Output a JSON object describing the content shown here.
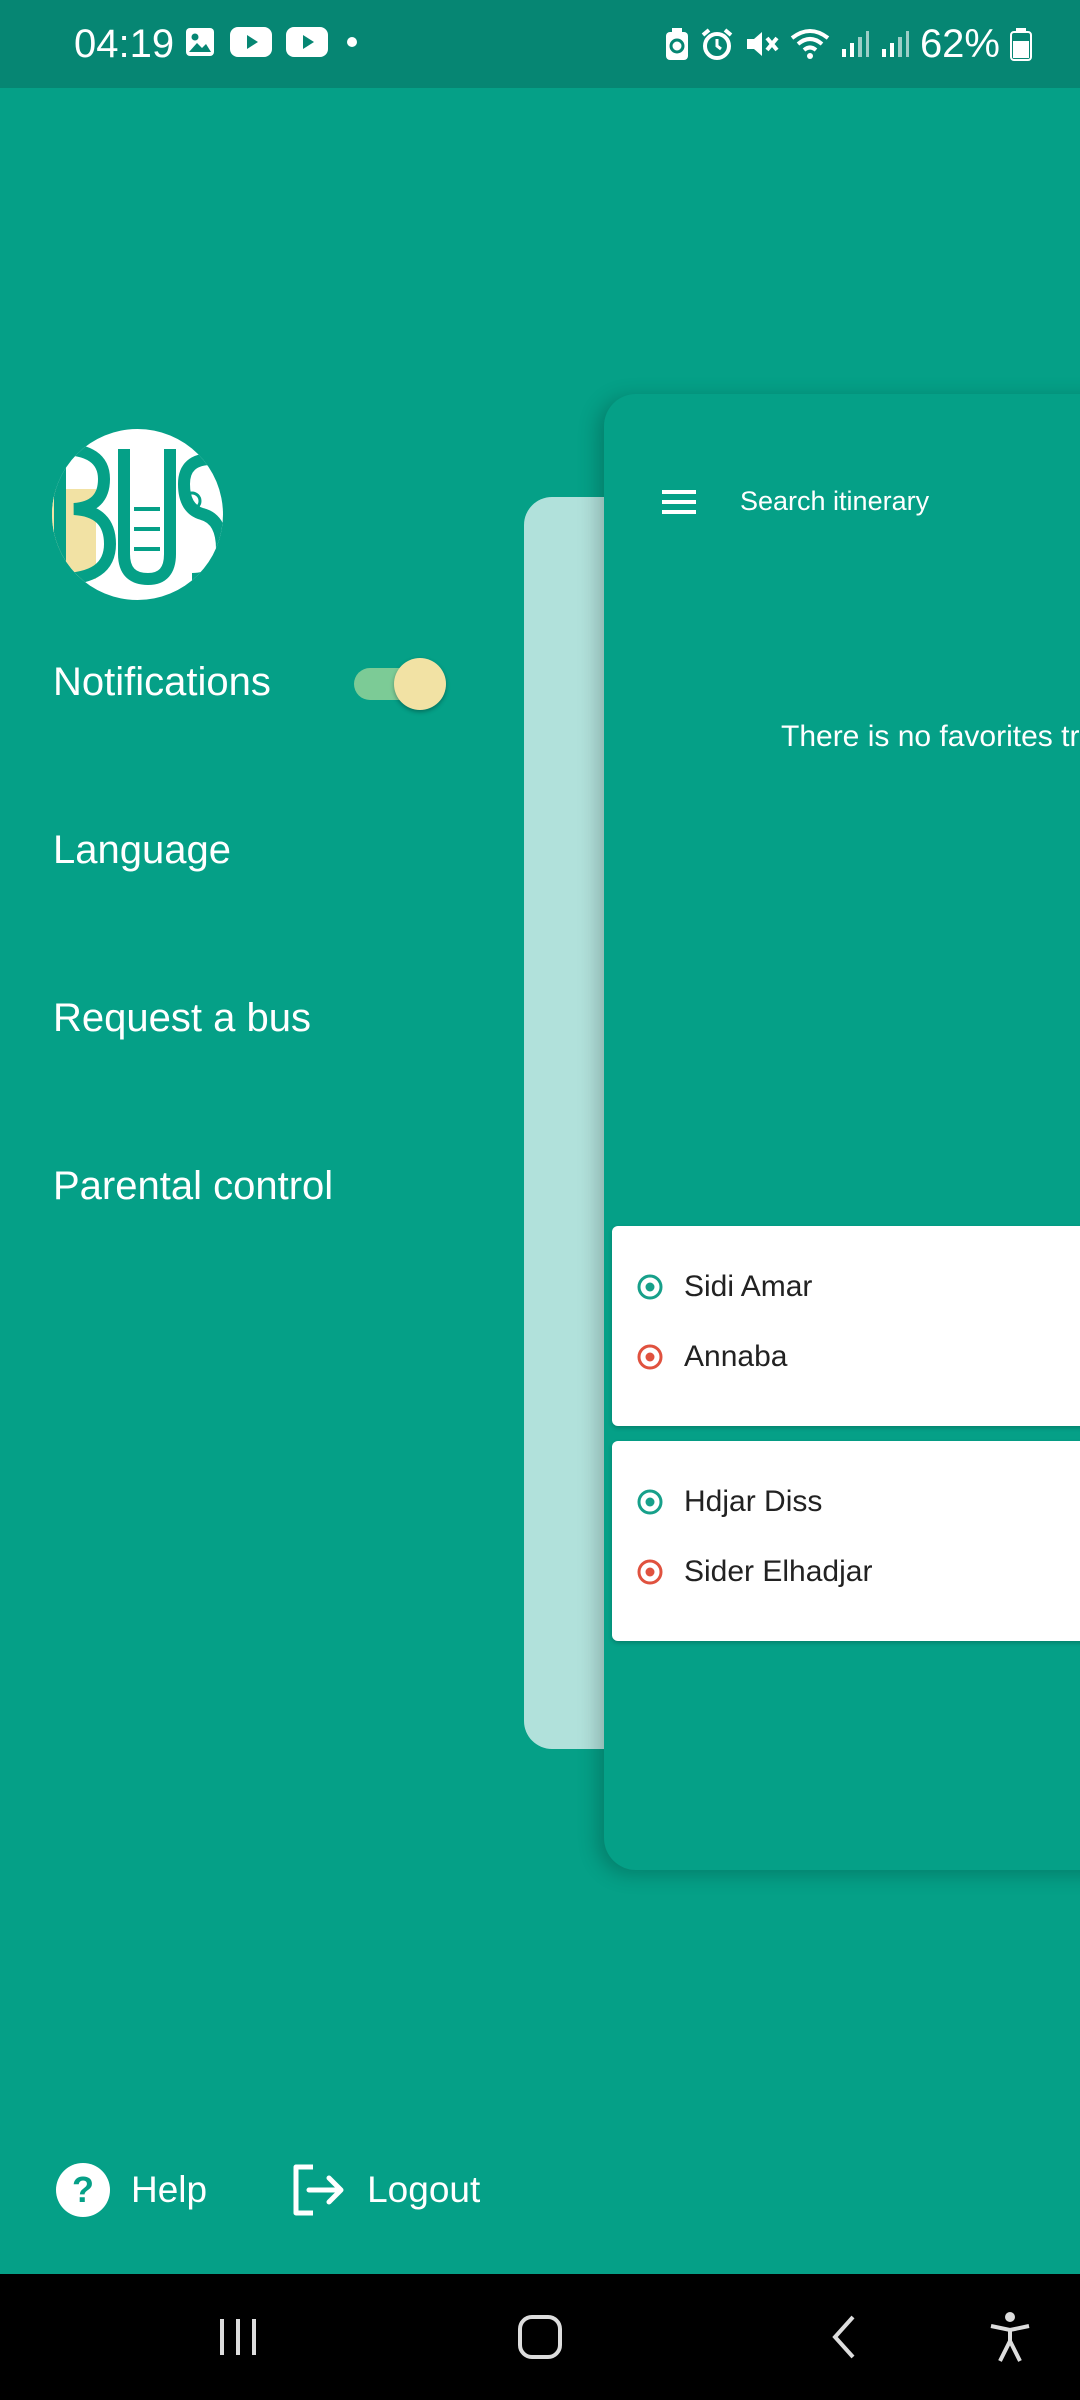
{
  "status_bar": {
    "time": "04:19",
    "battery_percent": "62%",
    "left_icons": [
      "gallery-icon",
      "youtube-icon",
      "youtube-icon",
      "dot-icon"
    ],
    "right_icons": [
      "battery-saver-icon",
      "alarm-icon",
      "mute-icon",
      "wifi-icon",
      "signal-icon",
      "signal-icon",
      "battery-icon"
    ]
  },
  "drawer": {
    "logo_text": "BUS",
    "notifications_label": "Notifications",
    "notifications_enabled": true,
    "items": [
      "Language",
      "Request a bus",
      "Parental control"
    ],
    "help_label": "Help",
    "logout_label": "Logout"
  },
  "main": {
    "search_placeholder": "Search itinerary",
    "empty_message": "There is no favorites tr",
    "routes": [
      {
        "from": "Sidi Amar",
        "to": "Annaba"
      },
      {
        "from": "Hdjar Diss",
        "to": "Sider Elhadjar"
      }
    ]
  },
  "colors": {
    "primary": "#05a087",
    "status_bar": "#068673",
    "origin_dot": "#17a08a",
    "destination_dot": "#e0523f",
    "toggle_thumb": "#f2e2a4"
  },
  "navbar": {
    "icons": [
      "recents-icon",
      "home-icon",
      "back-icon",
      "accessibility-icon"
    ]
  }
}
